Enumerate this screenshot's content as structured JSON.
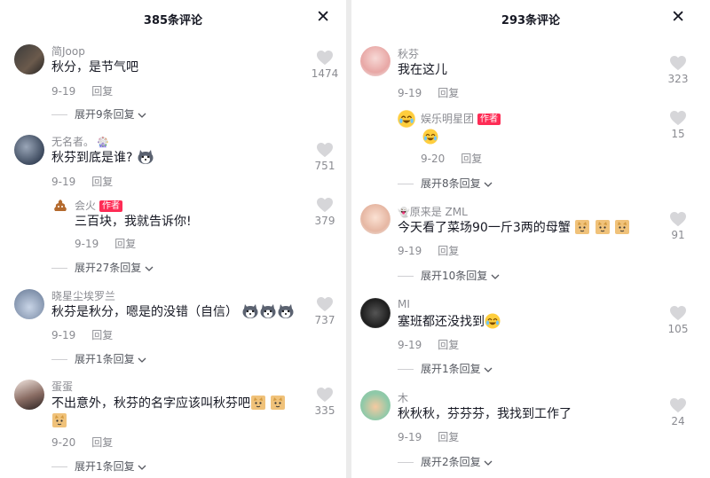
{
  "left_panel": {
    "title": "385条评论",
    "close_label": "✕",
    "comments": [
      {
        "user": "简Joop",
        "text": "秋分，是节气吧",
        "date": "9-19",
        "reply_label": "回复",
        "likes": "1474",
        "expand": "展开9条回复"
      },
      {
        "user": "无名者。",
        "text": "秋芬到底是谁?",
        "date": "9-19",
        "reply_label": "回复",
        "likes": "751",
        "sub": {
          "user": "会火",
          "author_tag": "作者",
          "text": "三百块，我就告诉你!",
          "date": "9-19",
          "reply_label": "回复",
          "likes": "379"
        },
        "expand": "展开27条回复"
      },
      {
        "user": "晓星尘埃罗兰",
        "text": "秋芬是秋分，嗯是的没错（自信）",
        "date": "9-19",
        "reply_label": "回复",
        "likes": "737",
        "expand": "展开1条回复"
      },
      {
        "user": "蛋蛋",
        "text": "不出意外，秋芬的名字应该叫秋芬吧",
        "date": "9-20",
        "reply_label": "回复",
        "likes": "335",
        "expand": "展开1条回复"
      }
    ]
  },
  "right_panel": {
    "title": "293条评论",
    "close_label": "✕",
    "comments": [
      {
        "user": "秋芬",
        "text": "我在这儿",
        "date": "9-19",
        "reply_label": "回复",
        "likes": "323",
        "sub": {
          "user": "娱乐明星团",
          "author_tag": "作者",
          "text": "",
          "date": "9-20",
          "reply_label": "回复",
          "likes": "15"
        },
        "expand": "展开8条回复"
      },
      {
        "user": "原来是 ZML",
        "text": "今天看了菜场90一斤3两的母蟹",
        "date": "9-19",
        "reply_label": "回复",
        "likes": "91",
        "expand": "展开10条回复"
      },
      {
        "user": "MI",
        "text": "塞班都还没找到",
        "date": "9-19",
        "reply_label": "回复",
        "likes": "105",
        "expand": "展开1条回复"
      },
      {
        "user": "木",
        "text": "秋秋秋，芬芬芬，我找到工作了",
        "date": "9-19",
        "reply_label": "回复",
        "likes": "24",
        "expand": "展开2条回复"
      }
    ]
  },
  "icons": {
    "like": "heart-icon",
    "close": "close-icon",
    "expand": "chevron-down-icon"
  },
  "colors": {
    "author_tag": "#fe2c55",
    "secondary_text": "#8a8b91",
    "heart": "#d6d6d9"
  }
}
